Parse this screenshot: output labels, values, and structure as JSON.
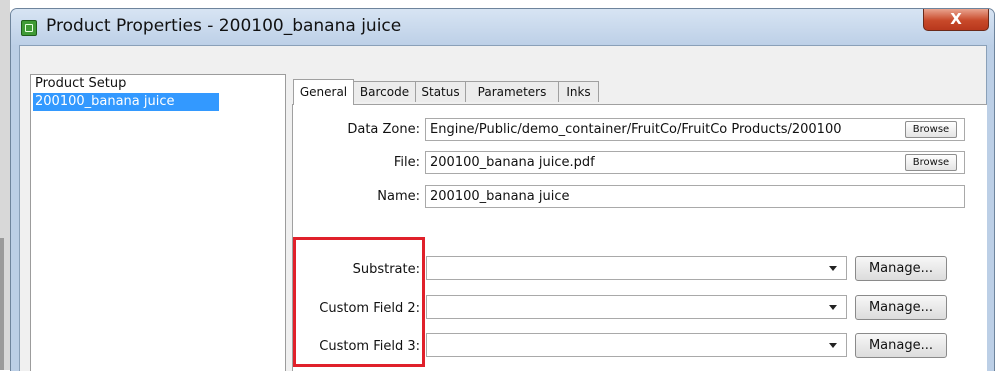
{
  "window": {
    "title": "Product Properties - 200100_banana juice",
    "close_glyph": "X"
  },
  "tree": {
    "items": [
      {
        "label": "Product Setup"
      },
      {
        "label": "200100_banana juice",
        "selected": true
      }
    ]
  },
  "tabs": [
    {
      "label": "General",
      "active": true
    },
    {
      "label": "Barcode"
    },
    {
      "label": "Status"
    },
    {
      "label": "Parameters"
    },
    {
      "label": "Inks"
    }
  ],
  "general": {
    "data_zone": {
      "label": "Data Zone:",
      "value": "Engine/Public/demo_container/FruitCo/FruitCo Products/200100",
      "browse": "Browse"
    },
    "file": {
      "label": "File:",
      "value": "200100_banana juice.pdf",
      "browse": "Browse"
    },
    "name": {
      "label": "Name:",
      "value": "200100_banana juice"
    },
    "fields": [
      {
        "label": "Substrate:",
        "value": "",
        "manage": "Manage..."
      },
      {
        "label": "Custom Field 2:",
        "value": "",
        "manage": "Manage..."
      },
      {
        "label": "Custom Field 3:",
        "value": "",
        "manage": "Manage..."
      }
    ]
  },
  "colors": {
    "selection": "#3399ff",
    "highlight_box": "#e0202a",
    "close_button": "#c8492a"
  },
  "icons": {
    "app": "app-icon",
    "close": "close-icon",
    "dropdown": "chevron-down-icon"
  }
}
